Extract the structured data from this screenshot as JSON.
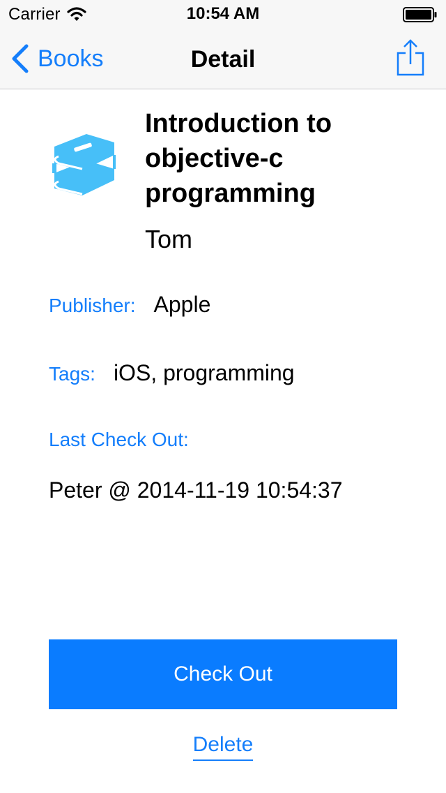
{
  "status_bar": {
    "carrier": "Carrier",
    "time": "10:54 AM",
    "wifi_icon": "wifi-icon",
    "battery_icon": "battery-icon"
  },
  "nav": {
    "back_label": "Books",
    "title": "Detail",
    "back_icon": "chevron-left-icon",
    "share_icon": "share-icon"
  },
  "book": {
    "icon": "books-icon",
    "title": "Introduction to objective-c programming",
    "author": "Tom",
    "publisher_label": "Publisher:",
    "publisher": "Apple",
    "tags_label": "Tags:",
    "tags": "iOS, programming",
    "last_checkout_label": "Last Check Out:",
    "last_checkout": "Peter @ 2014-11-19 10:54:37"
  },
  "actions": {
    "checkout_label": "Check Out",
    "delete_label": "Delete"
  },
  "colors": {
    "accent": "#147efb",
    "button": "#0a7cff",
    "book_icon": "#47bff8",
    "bar_background": "#f7f7f7"
  }
}
